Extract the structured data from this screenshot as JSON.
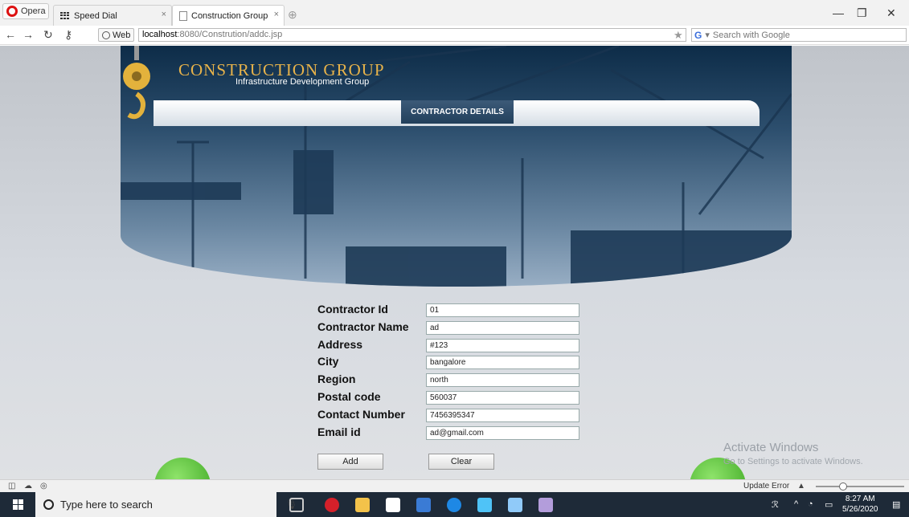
{
  "browser": {
    "menu_label": "Opera",
    "tabs": [
      {
        "label": "Speed Dial"
      },
      {
        "label": "Construction Group"
      }
    ],
    "web_badge": "Web",
    "url_host": "localhost",
    "url_path": ":8080/Constrution/addc.jsp",
    "search_placeholder": "Search with Google",
    "search_engine": "G"
  },
  "site": {
    "title": "CONSTRUCTION GROUP",
    "subtitle": "Infrastructure Development Group",
    "nav_item": "CONTRACTOR DETAILS"
  },
  "form": {
    "fields": [
      {
        "label": "Contractor Id",
        "value": "01"
      },
      {
        "label": "Contractor Name",
        "value": "ad"
      },
      {
        "label": "Address",
        "value": "#123"
      },
      {
        "label": "City",
        "value": "bangalore"
      },
      {
        "label": "Region",
        "value": "north"
      },
      {
        "label": "Postal code",
        "value": "560037"
      },
      {
        "label": "Contact Number",
        "value": "7456395347"
      },
      {
        "label": "Email id",
        "value": "ad@gmail.com"
      }
    ],
    "add_label": "Add",
    "clear_label": "Clear"
  },
  "watermark": {
    "line1": "Activate Windows",
    "line2": "Go to Settings to activate Windows."
  },
  "statusbar": {
    "update": "Update Error"
  },
  "taskbar": {
    "search_placeholder": "Type here to search",
    "time": "8:27 AM",
    "date": "5/26/2020"
  },
  "colors": {
    "brand_gold": "#e8b34a",
    "banner_dark": "#0d2c48",
    "nav_blue": "#2d4b69",
    "taskbar": "#1e2a38"
  }
}
